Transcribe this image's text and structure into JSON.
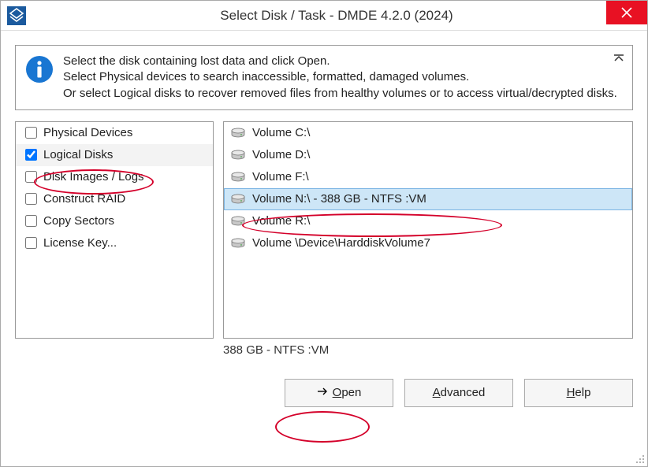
{
  "window": {
    "title": "Select Disk / Task - DMDE 4.2.0 (2024)"
  },
  "info": {
    "line1": "Select the disk containing lost data and click Open.",
    "line2": "Select Physical devices to search inaccessible, formatted, damaged volumes.",
    "line3": "Or select Logical disks to recover removed files from healthy volumes or to access virtual/decrypted disks."
  },
  "tasks": [
    {
      "label": "Physical Devices",
      "checked": false
    },
    {
      "label": "Logical Disks",
      "checked": true
    },
    {
      "label": "Disk Images / Logs",
      "checked": false
    },
    {
      "label": "Construct RAID",
      "checked": false
    },
    {
      "label": "Copy Sectors",
      "checked": false
    },
    {
      "label": "License Key...",
      "checked": false
    }
  ],
  "volumes": [
    {
      "label": "Volume C:\\",
      "selected": false
    },
    {
      "label": "Volume D:\\",
      "selected": false
    },
    {
      "label": "Volume F:\\",
      "selected": false
    },
    {
      "label": "Volume N:\\ - 388 GB - NTFS :VM",
      "selected": true
    },
    {
      "label": "Volume R:\\",
      "selected": false
    },
    {
      "label": "Volume \\Device\\HarddiskVolume7",
      "selected": false
    }
  ],
  "status": "388 GB - NTFS :VM",
  "buttons": {
    "open": "Open",
    "advanced": "Advanced",
    "help": "Help"
  }
}
